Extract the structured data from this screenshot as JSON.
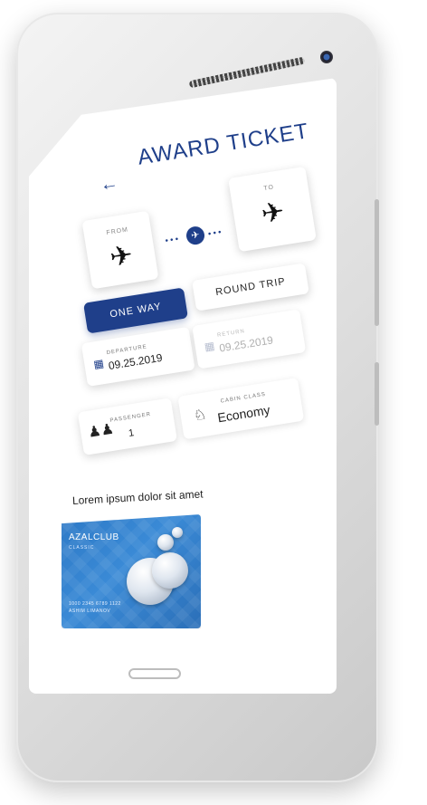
{
  "header": {
    "title": "AWARD TICKET",
    "back_icon": "arrow-left-icon"
  },
  "route": {
    "from_label": "FROM",
    "to_label": "TO",
    "from_icon": "plane-takeoff-icon",
    "to_icon": "plane-landing-icon",
    "connector_icon": "plane-icon"
  },
  "trip_type": {
    "one_way": "ONE WAY",
    "round_trip": "ROUND TRIP",
    "selected": "ONE WAY"
  },
  "dates": {
    "departure_label": "DEPARTURE",
    "departure_value": "09.25.2019",
    "return_label": "RETURN",
    "return_value": "09.25.2019",
    "icon": "calendar-icon"
  },
  "passenger": {
    "label": "PASSENGER",
    "value": "1",
    "icon": "people-icon"
  },
  "cabin": {
    "label": "CABIN CLASS",
    "value": "Economy",
    "icon": "seat-icon"
  },
  "promo": {
    "text": "Lorem ipsum dolor sit amet",
    "card_brand": "AZALCLUB",
    "card_tier": "CLASSIC",
    "card_number": "1000 2345 6789 1122",
    "card_holder": "ASHIM LIMANOV"
  },
  "colors": {
    "accent": "#1f3f8a",
    "card_blue": "#2d79c6"
  }
}
